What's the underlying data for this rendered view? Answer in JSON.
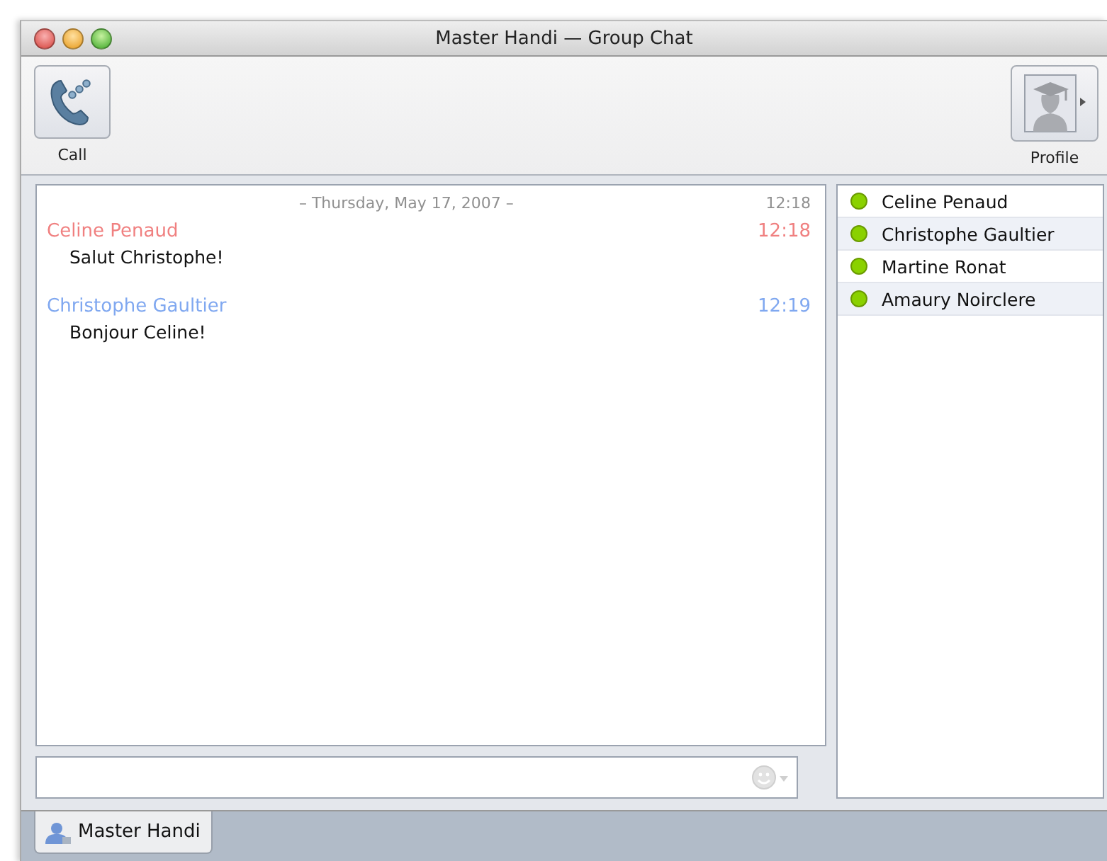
{
  "window": {
    "title": "Master Handi — Group Chat"
  },
  "toolbar": [
    {
      "kind": "call",
      "label": "Call"
    },
    {
      "kind": "profile",
      "label": "Profile"
    }
  ],
  "chat": {
    "date": "– Thursday, May 17, 2007 –",
    "date_time": "12:18",
    "messages": [
      {
        "sender": "Celine Penaud",
        "time": "12:18",
        "text": "Salut Christophe!",
        "color": "#f08080"
      },
      {
        "sender": "Christophe Gaultier",
        "time": "12:19",
        "text": "Bonjour Celine!",
        "color": "#80a8f0"
      }
    ]
  },
  "participants": [
    {
      "name": "Celine Penaud",
      "color": "#8ad100"
    },
    {
      "name": "Christophe Gaultier",
      "color": "#8ad100"
    },
    {
      "name": "Martine Ronat",
      "color": "#8ad100"
    },
    {
      "name": "Amaury Noirclere",
      "color": "#8ad100"
    }
  ],
  "tabs": [
    {
      "label": "Master Handi",
      "selected": true
    }
  ]
}
